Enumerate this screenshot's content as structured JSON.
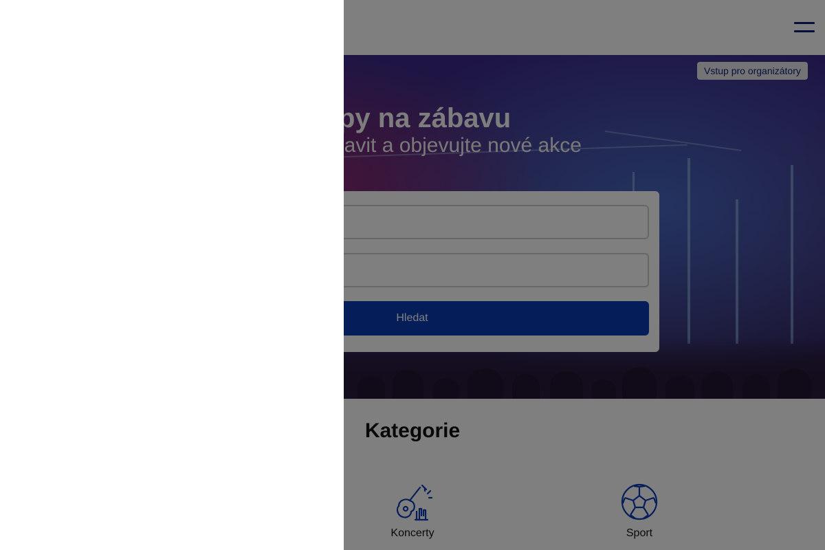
{
  "header": {
    "menu_icon": "hamburger-menu-icon"
  },
  "hero": {
    "organizer_button": "Vstup pro organizátory",
    "title": "py na zábavu",
    "subtitle": "bavit a objevujte nové akce"
  },
  "search": {
    "what_placeholder": "",
    "where_placeholder": "...",
    "button_label": "Hledat"
  },
  "categories": {
    "title": "Kategorie",
    "items": [
      {
        "label": "Koncerty",
        "icon": "guitar-rock-hand-icon"
      },
      {
        "label": "Sport",
        "icon": "soccer-ball-icon"
      }
    ]
  },
  "colors": {
    "brand_navy": "#0b1f6e",
    "primary_button": "#0b3bb0",
    "overlay": "rgba(0,0,0,0.5)"
  },
  "drawer": {
    "open": true
  }
}
